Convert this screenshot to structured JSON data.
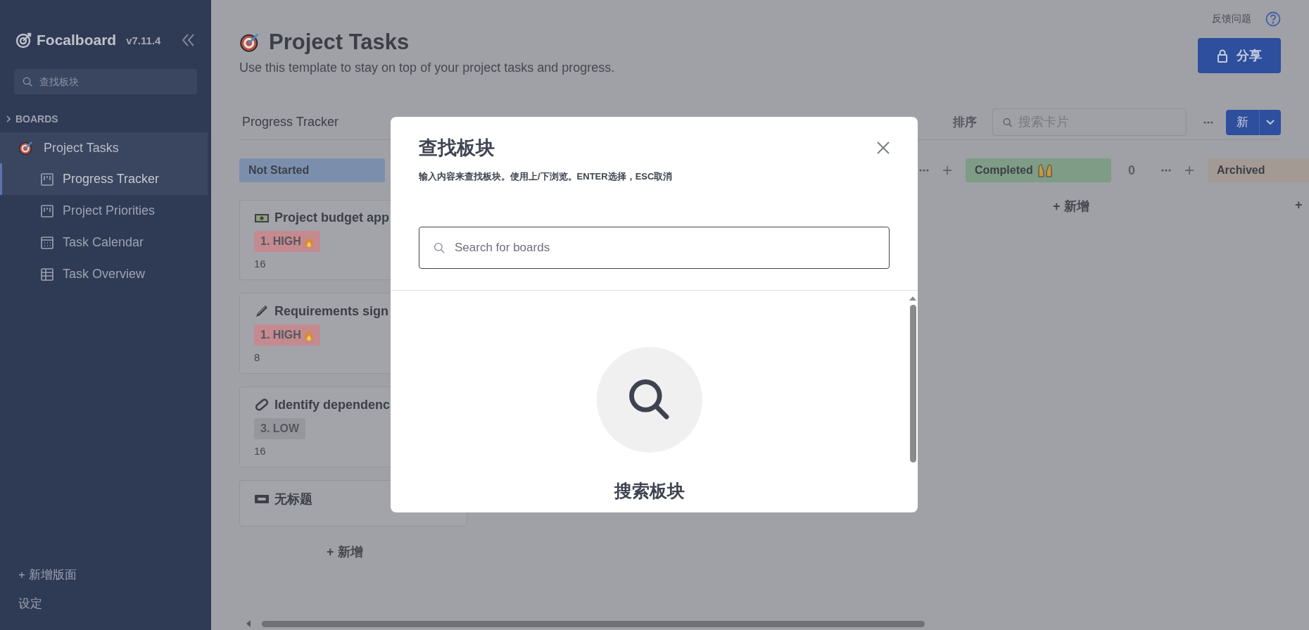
{
  "sidebar": {
    "logo": "Focalboard",
    "version": "v7.11.4",
    "search": {
      "placeholder": "查找板块"
    },
    "section": "BOARDS",
    "boards": [
      {
        "title": "Project Tasks",
        "children": [
          {
            "title": "Progress Tracker",
            "kind": "board",
            "selected": true
          },
          {
            "title": "Project Priorities",
            "kind": "board",
            "selected": false
          },
          {
            "title": "Task Calendar",
            "kind": "calendar",
            "selected": false
          },
          {
            "title": "Task Overview",
            "kind": "table",
            "selected": false
          }
        ]
      }
    ],
    "footer": [
      "+ 新增版面",
      "设定"
    ]
  },
  "header": {
    "feedback": "反馈问题",
    "share": "分享",
    "title": "Project Tasks",
    "description": "Use this template to stay on top of your project tasks and progress."
  },
  "toolbar": {
    "view": "Progress Tracker",
    "actions": [
      "排序"
    ],
    "search": {
      "placeholder": "搜索卡片"
    },
    "new": "新"
  },
  "columns": [
    {
      "kind": "status",
      "title": "Not Started",
      "color": "#7b8fad",
      "add": "+ 新增",
      "cards": [
        {
          "kind": "money",
          "title": "Project budget app",
          "tag": {
            "label": "1. HIGH",
            "color": "#c48a90"
          },
          "estimate": "16"
        },
        {
          "kind": "pen",
          "title": "Requirements sign",
          "tag": {
            "label": "1. HIGH",
            "color": "#c48a90"
          },
          "estimate": "8"
        },
        {
          "kind": "clip",
          "title": "Identify dependenc",
          "tag": {
            "label": "3. LOW",
            "color": "#96979d"
          },
          "estimate": "16"
        },
        {
          "kind": "tape",
          "title": "无标题"
        }
      ]
    },
    {
      "kind": "hidden"
    },
    {
      "kind": "covered"
    },
    {
      "kind": "done",
      "title": "Completed",
      "color": "#7f9c86",
      "count": "0",
      "add": "+ 新增"
    },
    {
      "kind": "status",
      "title": "Archived",
      "color": "#a39a94",
      "add": "+"
    }
  ],
  "modal": {
    "title": "查找板块",
    "hint": "输入内容来查找板块。使用上/下浏览。ENTER选择，ESC取消",
    "search": {
      "placeholder": "Search for boards"
    },
    "empty": "搜索板块"
  }
}
